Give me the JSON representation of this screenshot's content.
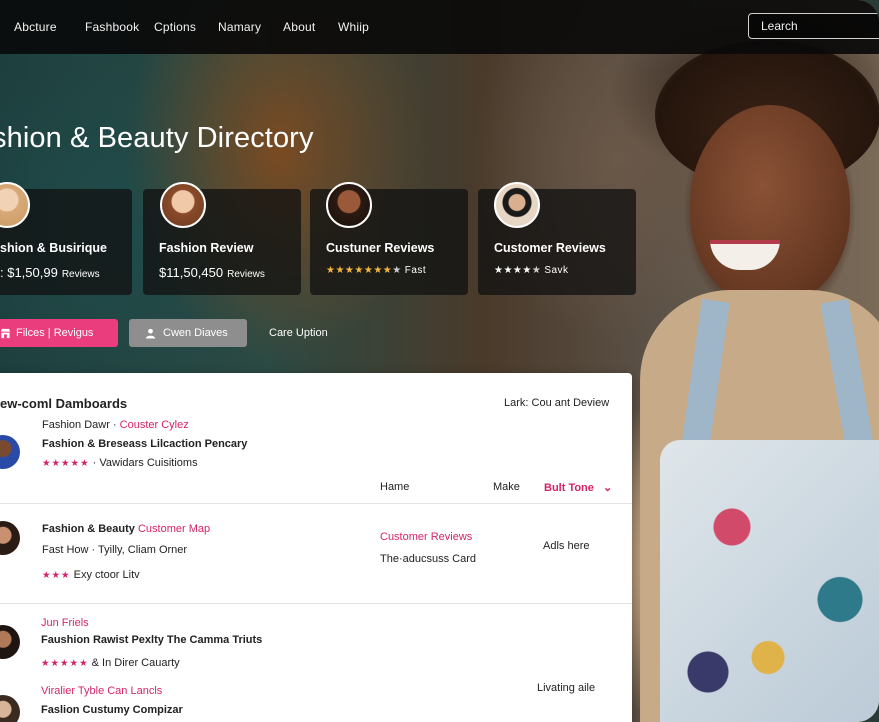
{
  "nav": {
    "items": [
      "Abcture",
      "Fashbook",
      "Cptions",
      "Namary",
      "About",
      "Whiip"
    ],
    "search_placeholder": "Learch"
  },
  "hero": {
    "title": "shion & Beauty Directory"
  },
  "cards": [
    {
      "title": "shion & Busirique",
      "value": ": $1,50,99",
      "unit": "Reviews"
    },
    {
      "title": "Fashion Review",
      "value": "$11,50,450",
      "unit": "Reviews"
    },
    {
      "title": "Custuner Reviews",
      "stars": "★★★★★★★",
      "dim": "★",
      "text": "Fast"
    },
    {
      "title": "Customer Reviews",
      "stars": "★★★★",
      "dim": "★",
      "text": "Savk"
    }
  ],
  "actions": {
    "primary": "Filces | Revigus",
    "secondary": "Cwen Diaves",
    "link": "Care Uption"
  },
  "panel": {
    "heading": "ew-coml Damboards",
    "right_heading": "Lark: Cou ant Deview",
    "row1": {
      "meta": "Fashion Dawr",
      "sep": " · ",
      "meta_link": "Couster Cylez",
      "title": "Fashion & Breseass Lilcaction Pencary",
      "stars": "★★★★★",
      "sub": "Vawidars Cuisitioms"
    },
    "columns": {
      "c1": "Hame",
      "c2": "Make",
      "c3": "Bult Tone",
      "chevron": "⌄"
    },
    "row2": {
      "title": "Fashion & Beauty",
      "title_link": "Customer Map",
      "meta": "Fast How",
      "meta_sep": " · ",
      "meta_rest": "Tyilly, Cliam Orner",
      "stars": "★★★",
      "sub": "Exy ctoor Litv",
      "mid_link": "Customer Reviews",
      "mid_text": "The·aducsuss Card",
      "right_text": "Adls here"
    },
    "row3": {
      "link": "Jun Friels",
      "title": "Faushion Rawist Pexlty The Camma Triuts",
      "stars": "★★★★★",
      "sub": "& In Direr Cauarty"
    },
    "row4": {
      "link": "Viralier Tyble Can Lancls",
      "title": "Faslion Custumy Compizar",
      "right_text": "Livating aile"
    }
  },
  "colors": {
    "accent": "#ea3d7e",
    "pink_text": "#d4236a",
    "nav_bg": "#0a0a0a",
    "star_gold": "#f4b63c"
  },
  "icons": [
    "store-icon",
    "user-icon",
    "chevron-down-icon"
  ]
}
